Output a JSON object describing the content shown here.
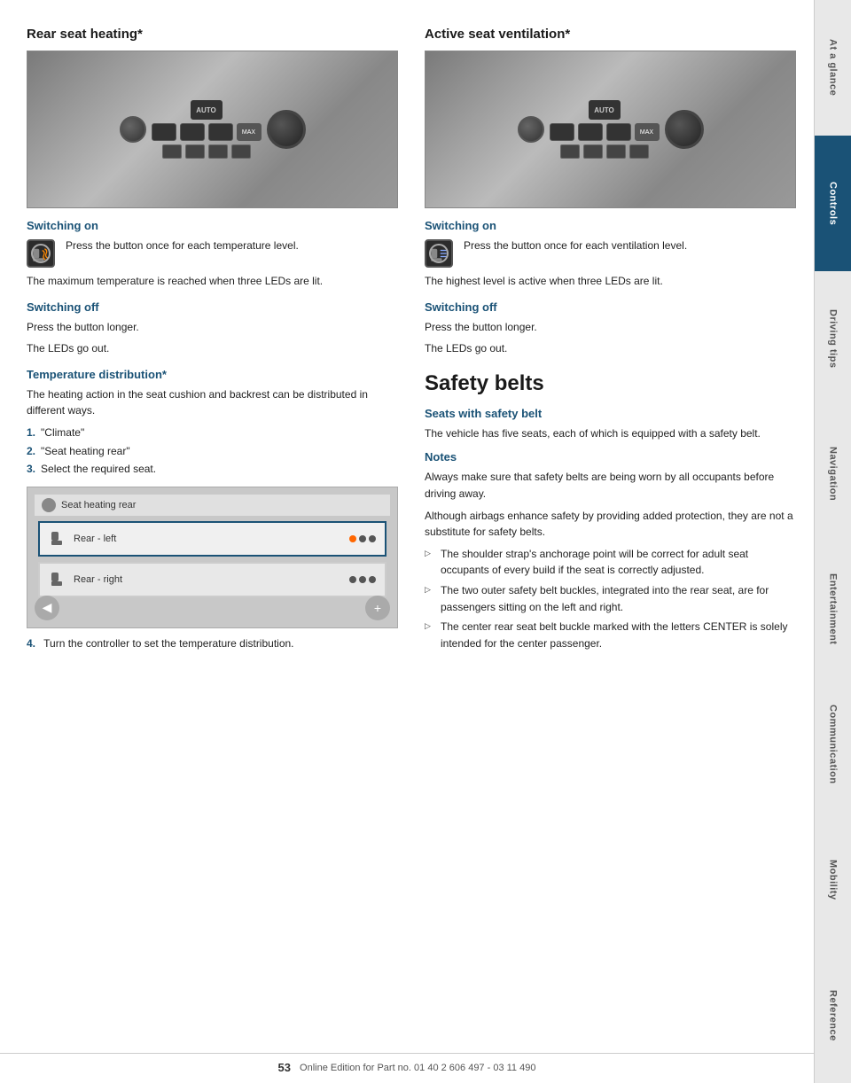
{
  "page": {
    "number": "53",
    "footer_text": "Online Edition for Part no. 01 40 2 606 497 - 03 11 490"
  },
  "sidebar": {
    "items": [
      {
        "id": "at-a-glance",
        "label": "At a glance",
        "active": false
      },
      {
        "id": "controls",
        "label": "Controls",
        "active": true
      },
      {
        "id": "driving-tips",
        "label": "Driving tips",
        "active": false
      },
      {
        "id": "navigation",
        "label": "Navigation",
        "active": false
      },
      {
        "id": "entertainment",
        "label": "Entertainment",
        "active": false
      },
      {
        "id": "communication",
        "label": "Communication",
        "active": false
      },
      {
        "id": "mobility",
        "label": "Mobility",
        "active": false
      },
      {
        "id": "reference",
        "label": "Reference",
        "active": false
      }
    ]
  },
  "left_column": {
    "title": "Rear seat heating*",
    "switching_on_title": "Switching on",
    "switching_on_text": "Press the button once for each temperature level.",
    "max_temp_text": "The maximum temperature is reached when three LEDs are lit.",
    "switching_off_title": "Switching off",
    "switching_off_text1": "Press the button longer.",
    "switching_off_text2": "The LEDs go out.",
    "temp_dist_title": "Temperature distribution*",
    "temp_dist_intro": "The heating action in the seat cushion and backrest can be distributed in different ways.",
    "list_items": [
      {
        "num": "1.",
        "text": "\"Climate\""
      },
      {
        "num": "2.",
        "text": "\"Seat heating rear\""
      },
      {
        "num": "3.",
        "text": "Select the required seat."
      }
    ],
    "screen_header": "Seat heating rear",
    "screen_row1": "Rear - left",
    "screen_row2": "Rear - right",
    "step4_text": "Turn the controller to set the temperature distribution."
  },
  "right_column": {
    "title": "Active seat ventilation*",
    "switching_on_title": "Switching on",
    "switching_on_text": "Press the button once for each ventilation level.",
    "highest_level_text": "The highest level is active when three LEDs are lit.",
    "switching_off_title": "Switching off",
    "switching_off_text1": "Press the button longer.",
    "switching_off_text2": "The LEDs go out.",
    "safety_belts_title": "Safety belts",
    "seats_title": "Seats with safety belt",
    "seats_text": "The vehicle has five seats, each of which is equipped with a safety belt.",
    "notes_title": "Notes",
    "notes_text1": "Always make sure that safety belts are being worn by all occupants before driving away.",
    "notes_text2": "Although airbags enhance safety by providing added protection, they are not a substitute for safety belts.",
    "bullet_items": [
      "The shoulder strap's anchorage point will be correct for adult seat occupants of every build if the seat is correctly adjusted.",
      "The two outer safety belt buckles, integrated into the rear seat, are for passengers sitting on the left and right.",
      "The center rear seat belt buckle marked with the letters CENTER is solely intended for the center passenger."
    ]
  }
}
